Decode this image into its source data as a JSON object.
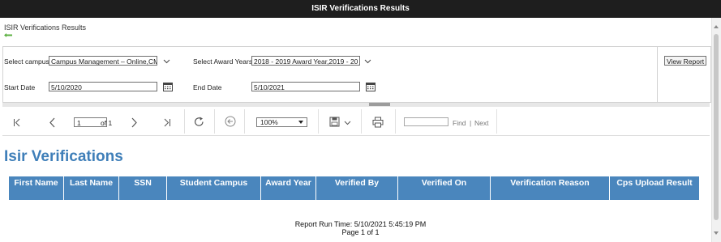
{
  "window": {
    "title": "ISIR Verifications Results"
  },
  "page": {
    "title": "ISIR Verifications Results"
  },
  "params": {
    "campus_label": "Select campus",
    "campus_value": "Campus Management – Online,CM",
    "award_years_label": "Select Award Years",
    "award_years_value": "2018 - 2019 Award Year,2019 - 20",
    "start_date_label": "Start Date",
    "start_date_value": "5/10/2020",
    "end_date_label": "End Date",
    "end_date_value": "5/10/2021",
    "view_report_label": "View Report"
  },
  "toolbar": {
    "current_page": "1",
    "of_text": "of 1",
    "zoom": "100%",
    "find_label": "Find",
    "separator": "|",
    "next_label": "Next",
    "icons": [
      "first-page-icon",
      "previous-page-icon",
      "next-page-icon",
      "last-page-icon",
      "refresh-icon",
      "back-icon",
      "save-icon",
      "print-icon"
    ]
  },
  "report": {
    "title": "Isir Verifications",
    "columns": [
      "First Name",
      "Last Name",
      "SSN",
      "Student Campus",
      "Award Year",
      "Verified By",
      "Verified On",
      "Verification Reason",
      "Cps Upload Result"
    ],
    "run_time": "Report Run Time: 5/10/2021 5:45:19 PM",
    "page_info": "Page 1 of 1"
  },
  "colors": {
    "titlebar": "#1e1e1e",
    "accent": "#3f7fb9",
    "header_bg": "#4a86bd",
    "back_icon": "#5bb040"
  }
}
